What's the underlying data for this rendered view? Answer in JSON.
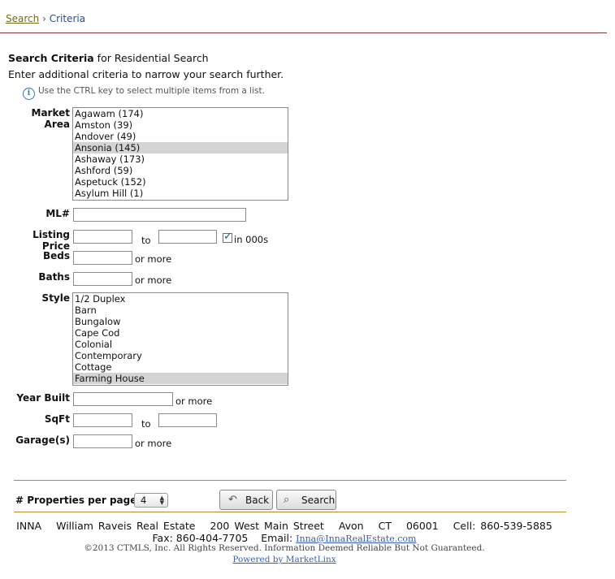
{
  "breadcrumb": {
    "link": "Search",
    "separator": "›",
    "current": "Criteria"
  },
  "heading": {
    "bold": "Search Criteria",
    "rest": " for Residential Search"
  },
  "subtitle": "Enter additional criteria to narrow your search further.",
  "hint": {
    "icon": "info-icon",
    "text": "Use the CTRL key to select multiple items from a list."
  },
  "labels": {
    "market_area": "Market Area",
    "ml": "ML#",
    "listing_price": "Listing Price",
    "beds": "Beds",
    "baths": "Baths",
    "style": "Style",
    "year_built": "Year Built",
    "sqft": "SqFt",
    "garage": "Garage(s)"
  },
  "market_area_options": [
    {
      "label": "Agawam (174)",
      "selected": false
    },
    {
      "label": "Amston (39)",
      "selected": false
    },
    {
      "label": "Andover (49)",
      "selected": false
    },
    {
      "label": "Ansonia (145)",
      "selected": true
    },
    {
      "label": "Ashaway (173)",
      "selected": false
    },
    {
      "label": "Ashford (59)",
      "selected": false
    },
    {
      "label": "Aspetuck (152)",
      "selected": false
    },
    {
      "label": "Asylum Hill (1)",
      "selected": false
    }
  ],
  "style_options": [
    {
      "label": "1/2 Duplex",
      "selected": false
    },
    {
      "label": "Barn",
      "selected": false
    },
    {
      "label": "Bungalow",
      "selected": false
    },
    {
      "label": "Cape Cod",
      "selected": false
    },
    {
      "label": "Colonial",
      "selected": false
    },
    {
      "label": "Contemporary",
      "selected": false
    },
    {
      "label": "Cottage",
      "selected": false
    },
    {
      "label": "Farming House",
      "selected": true
    }
  ],
  "text": {
    "to": "to",
    "or_more": "or more",
    "in_000s": "in 000s"
  },
  "in_000s_checked": true,
  "per_page": {
    "label": "# Properties per page",
    "value": "4"
  },
  "buttons": {
    "back": "Back",
    "search": "Search"
  },
  "footer": {
    "name": "INNA",
    "company": "William Raveis Real Estate",
    "address": "200 West Main Street",
    "city": "Avon",
    "state": "CT",
    "zip": "06001",
    "cell": "Cell: 860-539-5885",
    "fax": "Fax: 860-404-7705",
    "email_label": "Email:",
    "email": "Inna@InnaRealEstate.com",
    "copyright": "©2013 CTMLS, Inc. All Rights Reserved. Information Deemed Reliable But Not Guaranteed.",
    "powered": "Powered by MarketLinx"
  },
  "colors": {
    "rule": "#7a3b2e",
    "gold_rule": "#b5892f",
    "link": "#3b5fb0",
    "crumb_link": "#6f6d1f"
  }
}
